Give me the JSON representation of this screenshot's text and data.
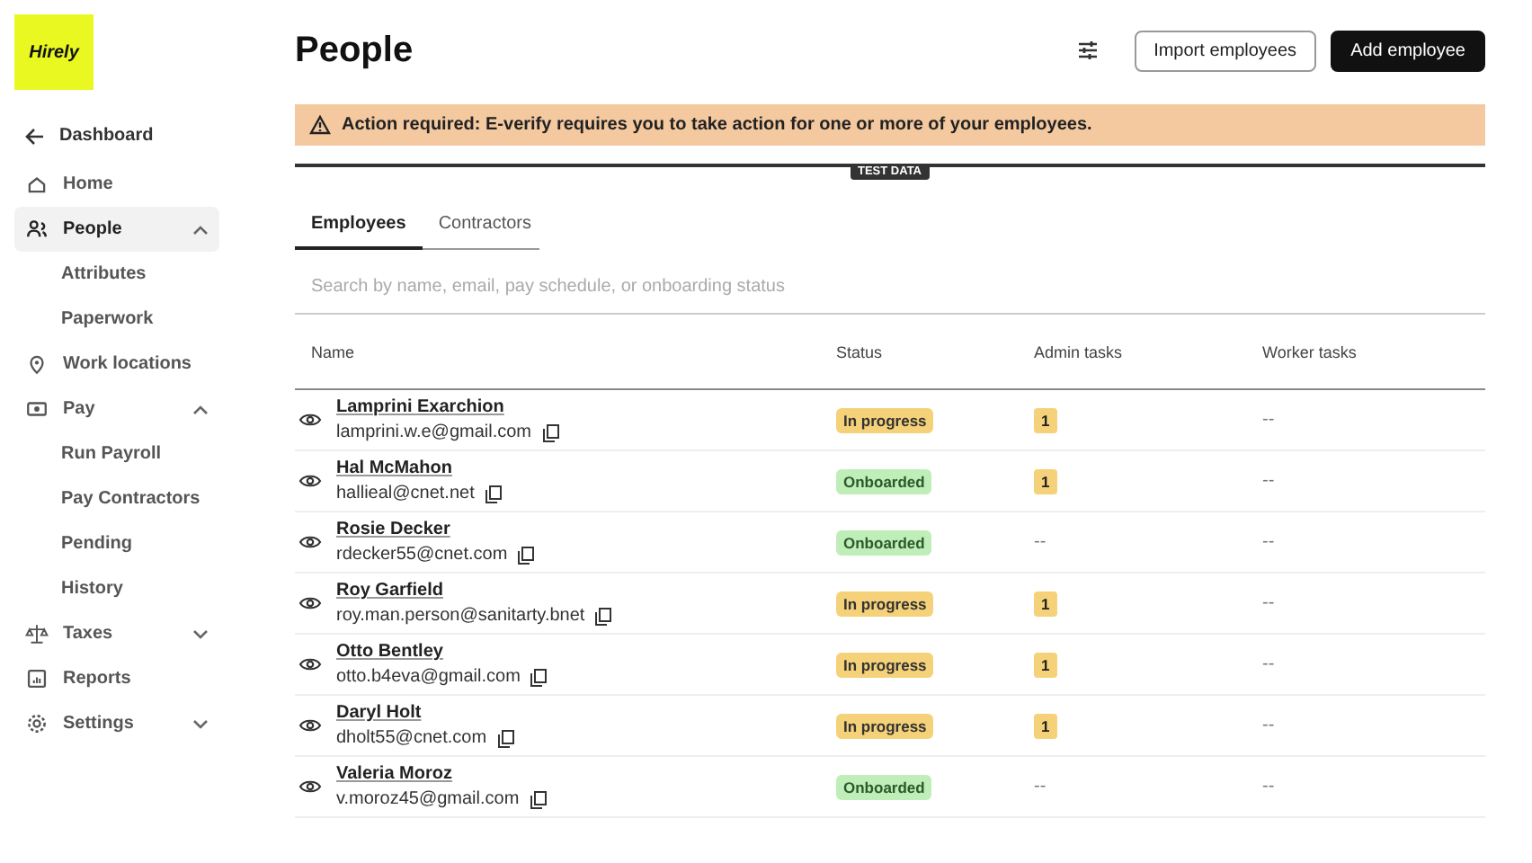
{
  "logo": {
    "text": "Hirely"
  },
  "sidebar": {
    "back": {
      "label": "Dashboard"
    },
    "items": [
      {
        "label": "Home",
        "kind": "home",
        "selected": false
      },
      {
        "label": "People",
        "kind": "people",
        "selected": true,
        "expanded": true,
        "children": [
          {
            "label": "Attributes"
          },
          {
            "label": "Paperwork"
          }
        ]
      },
      {
        "label": "Work locations",
        "kind": "pin",
        "selected": false
      },
      {
        "label": "Pay",
        "kind": "cash",
        "selected": false,
        "expanded": true,
        "children": [
          {
            "label": "Run Payroll"
          },
          {
            "label": "Pay Contractors"
          },
          {
            "label": "Pending"
          },
          {
            "label": "History"
          }
        ]
      },
      {
        "label": "Taxes",
        "kind": "scale",
        "selected": false,
        "expanded": false
      },
      {
        "label": "Reports",
        "kind": "report",
        "selected": false
      },
      {
        "label": "Settings",
        "kind": "gear",
        "selected": false,
        "expanded": false
      }
    ]
  },
  "header": {
    "title": "People",
    "buttons": [
      {
        "label": "Import employees",
        "kind": "secondary"
      },
      {
        "label": "Add employee",
        "kind": "primary"
      }
    ]
  },
  "alert": {
    "title": "Action required:",
    "text": "E-verify requires you to take action for one or more of your employees."
  },
  "test_data_label": "TEST DATA",
  "tabs": [
    {
      "label": "Employees",
      "selected": true
    },
    {
      "label": "Contractors",
      "selected": false
    }
  ],
  "search": {
    "placeholder": "Search by name, email, pay schedule, or onboarding status"
  },
  "table": {
    "columns": [
      "Name",
      "Status",
      "Admin tasks",
      "Worker tasks"
    ],
    "rows": [
      {
        "name": "Lamprini Exarchion",
        "email": "lamprini.w.e@gmail.com",
        "status": {
          "text": "In progress",
          "kind": "in_progress"
        },
        "admin_tasks": {
          "text": "1",
          "kind": "badge"
        },
        "worker_tasks": "--"
      },
      {
        "name": "Hal McMahon",
        "email": "hallieal@cnet.net",
        "status": {
          "text": "Onboarded",
          "kind": "onboarded"
        },
        "admin_tasks": {
          "text": "1",
          "kind": "badge"
        },
        "worker_tasks": "--"
      },
      {
        "name": "Rosie Decker",
        "email": "rdecker55@cnet.com",
        "status": {
          "text": "Onboarded",
          "kind": "onboarded"
        },
        "admin_tasks": {
          "text": "--",
          "kind": "empty"
        },
        "worker_tasks": "--"
      },
      {
        "name": "Roy Garfield",
        "email": "roy.man.person@sanitarty.bnet",
        "status": {
          "text": "In progress",
          "kind": "in_progress"
        },
        "admin_tasks": {
          "text": "1",
          "kind": "badge"
        },
        "worker_tasks": "--"
      },
      {
        "name": "Otto Bentley",
        "email": "otto.b4eva@gmail.com",
        "status": {
          "text": "In progress",
          "kind": "in_progress"
        },
        "admin_tasks": {
          "text": "1",
          "kind": "badge"
        },
        "worker_tasks": "--"
      },
      {
        "name": "Daryl Holt",
        "email": "dholt55@cnet.com",
        "status": {
          "text": "In progress",
          "kind": "in_progress"
        },
        "admin_tasks": {
          "text": "1",
          "kind": "badge"
        },
        "worker_tasks": "--"
      },
      {
        "name": "Valeria Moroz",
        "email": "v.moroz45@gmail.com",
        "status": {
          "text": "Onboarded",
          "kind": "onboarded"
        },
        "admin_tasks": {
          "text": "--",
          "kind": "empty"
        },
        "worker_tasks": "--"
      }
    ]
  }
}
